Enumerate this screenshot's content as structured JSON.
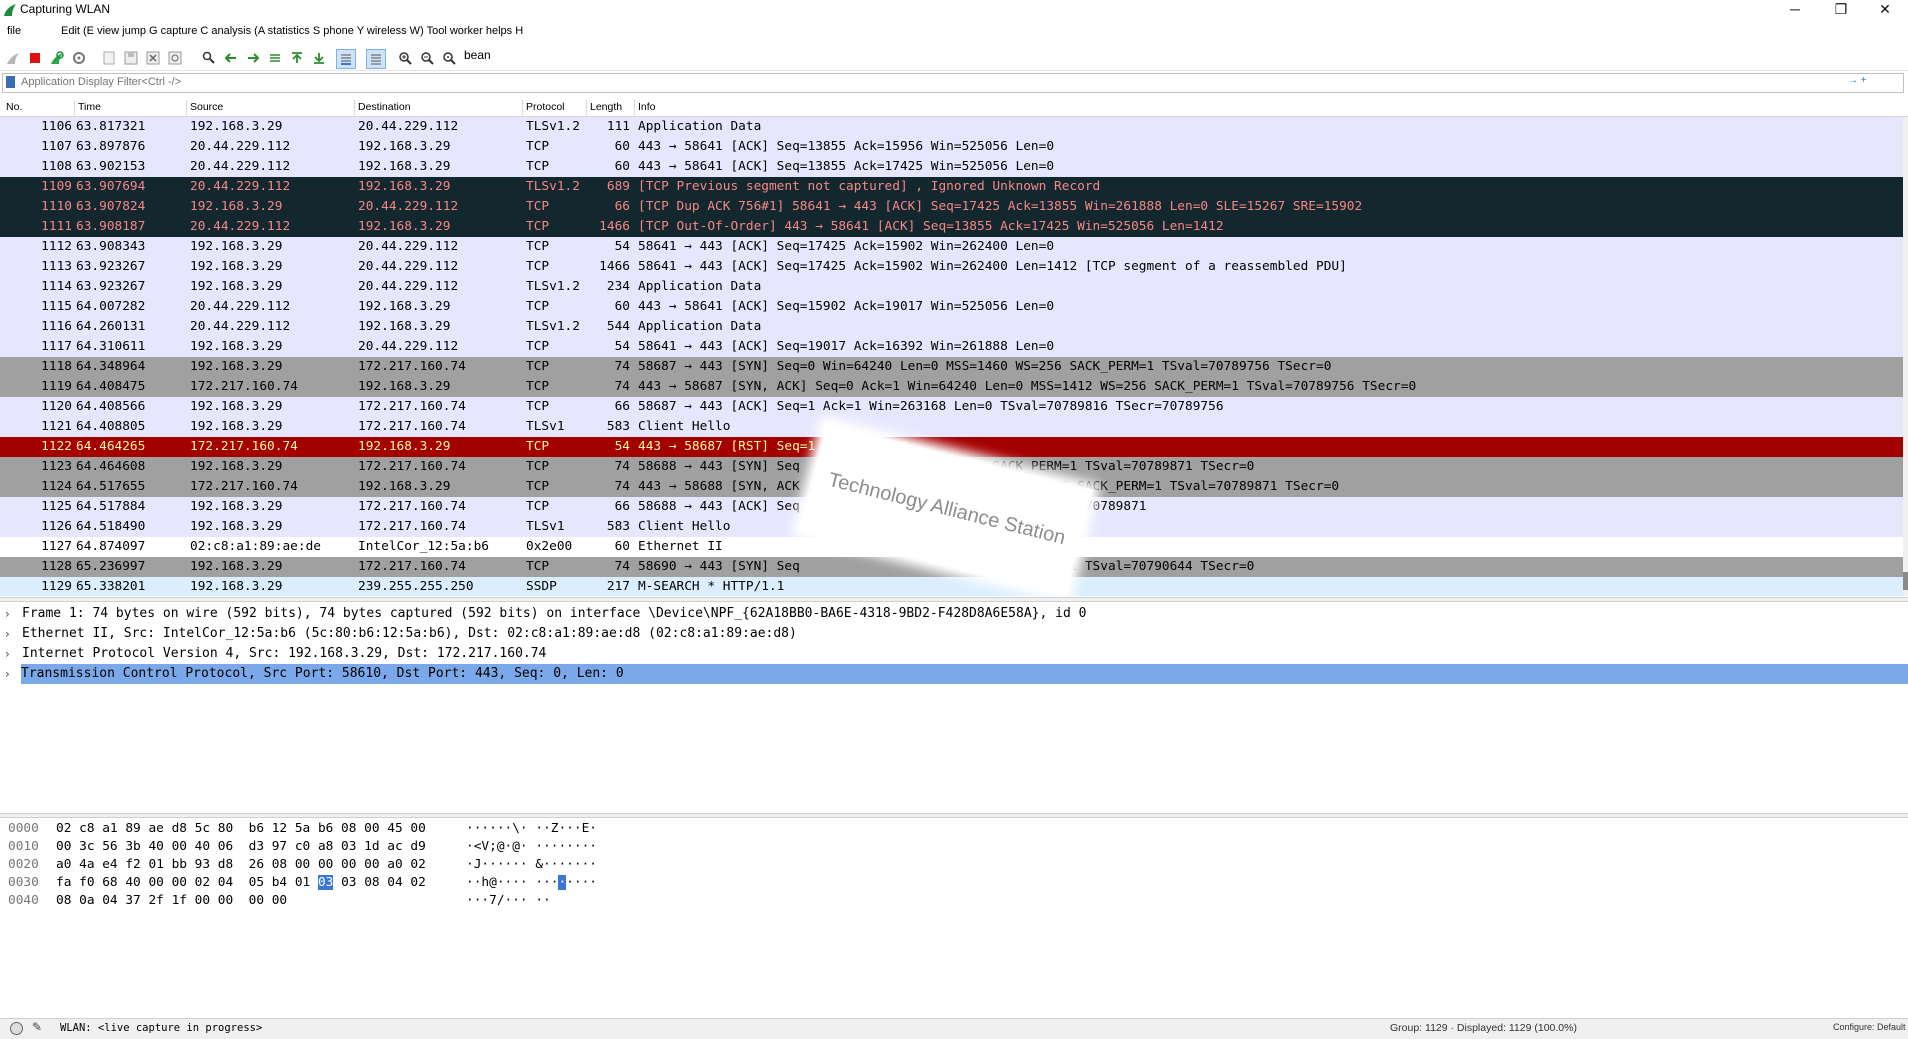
{
  "window": {
    "title": "Capturing WLAN",
    "controls": [
      "─",
      "❐",
      "✕"
    ]
  },
  "menu": {
    "items": [
      "file",
      "Edit (E view jump G capture C analysis (A statistics S phone Y wireless W) Tool worker helps H"
    ]
  },
  "toolbar": {
    "icons": [
      "shark-fin-start-icon",
      "stop-capture-icon",
      "restart-capture-icon",
      "capture-options-icon",
      "open-file-icon",
      "save-file-icon",
      "close-file-icon",
      "reload-file-icon",
      "find-packet-icon",
      "go-back-icon",
      "go-forward-icon",
      "go-to-packet-icon",
      "go-first-icon",
      "go-last-icon",
      "autoscroll-icon",
      "colorize-icon",
      "zoom-in-icon",
      "zoom-out-icon",
      "zoom-normal-icon"
    ],
    "extra_label": "bean"
  },
  "filter": {
    "placeholder": "Application Display Filter<Ctrl -/>"
  },
  "packet_list": {
    "columns": [
      "No.",
      "Time",
      "Source",
      "Destination",
      "Protocol",
      "Length",
      "Info"
    ],
    "rows": [
      {
        "no": "1106",
        "time": "63.817321",
        "src": "192.168.3.29",
        "dst": "20.44.229.112",
        "proto": "TLSv1.2",
        "len": "111",
        "info": "Application Data",
        "style": "tcp"
      },
      {
        "no": "1107",
        "time": "63.897876",
        "src": "20.44.229.112",
        "dst": "192.168.3.29",
        "proto": "TCP",
        "len": "60",
        "info": "443 → 58641 [ACK] Seq=13855 Ack=15956 Win=525056 Len=0",
        "style": "tcp"
      },
      {
        "no": "1108",
        "time": "63.902153",
        "src": "20.44.229.112",
        "dst": "192.168.3.29",
        "proto": "TCP",
        "len": "60",
        "info": "443 → 58641 [ACK] Seq=13855 Ack=17425 Win=525056 Len=0",
        "style": "tcp"
      },
      {
        "no": "1109",
        "time": "63.907694",
        "src": "20.44.229.112",
        "dst": "192.168.3.29",
        "proto": "TLSv1.2",
        "len": "689",
        "info": "[TCP Previous segment not captured] , Ignored Unknown Record",
        "style": "bad"
      },
      {
        "no": "1110",
        "time": "63.907824",
        "src": "192.168.3.29",
        "dst": "20.44.229.112",
        "proto": "TCP",
        "len": "66",
        "info": "[TCP Dup ACK 756#1] 58641 → 443 [ACK] Seq=17425 Ack=13855 Win=261888 Len=0 SLE=15267 SRE=15902",
        "style": "bad"
      },
      {
        "no": "1111",
        "time": "63.908187",
        "src": "20.44.229.112",
        "dst": "192.168.3.29",
        "proto": "TCP",
        "len": "1466",
        "info": "[TCP Out-Of-Order] 443 → 58641 [ACK] Seq=13855 Ack=17425 Win=525056 Len=1412",
        "style": "bad"
      },
      {
        "no": "1112",
        "time": "63.908343",
        "src": "192.168.3.29",
        "dst": "20.44.229.112",
        "proto": "TCP",
        "len": "54",
        "info": "58641 → 443 [ACK] Seq=17425 Ack=15902 Win=262400 Len=0",
        "style": "tcp"
      },
      {
        "no": "1113",
        "time": "63.923267",
        "src": "192.168.3.29",
        "dst": "20.44.229.112",
        "proto": "TCP",
        "len": "1466",
        "info": "58641 → 443 [ACK] Seq=17425 Ack=15902 Win=262400 Len=1412 [TCP segment of a reassembled PDU]",
        "style": "tcp"
      },
      {
        "no": "1114",
        "time": "63.923267",
        "src": "192.168.3.29",
        "dst": "20.44.229.112",
        "proto": "TLSv1.2",
        "len": "234",
        "info": "Application Data",
        "style": "tcp"
      },
      {
        "no": "1115",
        "time": "64.007282",
        "src": "20.44.229.112",
        "dst": "192.168.3.29",
        "proto": "TCP",
        "len": "60",
        "info": "443 → 58641 [ACK] Seq=15902 Ack=19017 Win=525056 Len=0",
        "style": "tcp"
      },
      {
        "no": "1116",
        "time": "64.260131",
        "src": "20.44.229.112",
        "dst": "192.168.3.29",
        "proto": "TLSv1.2",
        "len": "544",
        "info": "Application Data",
        "style": "tcp"
      },
      {
        "no": "1117",
        "time": "64.310611",
        "src": "192.168.3.29",
        "dst": "20.44.229.112",
        "proto": "TCP",
        "len": "54",
        "info": "58641 → 443 [ACK] Seq=19017 Ack=16392 Win=261888 Len=0",
        "style": "tcp"
      },
      {
        "no": "1118",
        "time": "64.348964",
        "src": "192.168.3.29",
        "dst": "172.217.160.74",
        "proto": "TCP",
        "len": "74",
        "info": "58687 → 443 [SYN] Seq=0 Win=64240 Len=0 MSS=1460 WS=256 SACK_PERM=1 TSval=70789756 TSecr=0",
        "style": "syn"
      },
      {
        "no": "1119",
        "time": "64.408475",
        "src": "172.217.160.74",
        "dst": "192.168.3.29",
        "proto": "TCP",
        "len": "74",
        "info": "443 → 58687 [SYN, ACK] Seq=0 Ack=1 Win=64240 Len=0 MSS=1412 WS=256 SACK_PERM=1 TSval=70789756 TSecr=0",
        "style": "syn"
      },
      {
        "no": "1120",
        "time": "64.408566",
        "src": "192.168.3.29",
        "dst": "172.217.160.74",
        "proto": "TCP",
        "len": "66",
        "info": "58687 → 443 [ACK] Seq=1 Ack=1 Win=263168 Len=0 TSval=70789816 TSecr=70789756",
        "style": "tcp"
      },
      {
        "no": "1121",
        "time": "64.408805",
        "src": "192.168.3.29",
        "dst": "172.217.160.74",
        "proto": "TLSv1",
        "len": "583",
        "info": "Client Hello",
        "style": "tcp"
      },
      {
        "no": "1122",
        "time": "64.464265",
        "src": "172.217.160.74",
        "dst": "192.168.3.29",
        "proto": "TCP",
        "len": "54",
        "info": "443 → 58687 [RST] Seq=1 Win=0 Len=0",
        "style": "rst"
      },
      {
        "no": "1123",
        "time": "64.464608",
        "src": "192.168.3.29",
        "dst": "172.217.160.74",
        "proto": "TCP",
        "len": "74",
        "info": "58688 → 443 [SYN] Seq                         SACK_PERM=1 TSval=70789871 TSecr=0",
        "style": "syn"
      },
      {
        "no": "1124",
        "time": "64.517655",
        "src": "172.217.160.74",
        "dst": "192.168.3.29",
        "proto": "TCP",
        "len": "74",
        "info": "443 → 58688 [SYN, ACK                         412 WS=256 SACK_PERM=1 TSval=70789871 TSecr=0",
        "style": "syn"
      },
      {
        "no": "1125",
        "time": "64.517884",
        "src": "192.168.3.29",
        "dst": "172.217.160.74",
        "proto": "TCP",
        "len": "66",
        "info": "58688 → 443 [ACK] Seq                         89925 TSecr=70789871",
        "style": "tcp"
      },
      {
        "no": "1126",
        "time": "64.518490",
        "src": "192.168.3.29",
        "dst": "172.217.160.74",
        "proto": "TLSv1",
        "len": "583",
        "info": "Client Hello",
        "style": "tcp"
      },
      {
        "no": "1127",
        "time": "64.874097",
        "src": "02:c8:a1:89:ae:de",
        "dst": "IntelCor_12:5a:b6",
        "proto": "0x2e00",
        "len": "60",
        "info": "Ethernet II",
        "style": "plain"
      },
      {
        "no": "1128",
        "time": "65.236997",
        "src": "192.168.3.29",
        "dst": "172.217.160.74",
        "proto": "TCP",
        "len": "74",
        "info": "58690 → 443 [SYN] Seq                         SACK_PERM=1 TSval=70790644 TSecr=0",
        "style": "syn"
      },
      {
        "no": "1129",
        "time": "65.338201",
        "src": "192.168.3.29",
        "dst": "239.255.255.250",
        "proto": "SSDP",
        "len": "217",
        "info": "M-SEARCH * HTTP/1.1",
        "style": "ssdp"
      }
    ]
  },
  "watermark": {
    "text": "Technology Alliance Station"
  },
  "details": {
    "rows": [
      {
        "text": "Frame 1: 74 bytes on wire (592 bits), 74 bytes captured (592 bits) on interface \\Device\\NPF_{62A18BB0-BA6E-4318-9BD2-F428D8A6E58A}, id 0",
        "selected": false
      },
      {
        "text": "Ethernet II, Src: IntelCor_12:5a:b6 (5c:80:b6:12:5a:b6), Dst: 02:c8:a1:89:ae:d8 (02:c8:a1:89:ae:d8)",
        "selected": false
      },
      {
        "text": "Internet Protocol Version 4, Src: 192.168.3.29, Dst: 172.217.160.74",
        "selected": false
      },
      {
        "text": "Transmission Control Protocol, Src Port: 58610, Dst Port: 443, Seq: 0, Len: 0",
        "selected": true
      }
    ]
  },
  "bytes": {
    "rows": [
      {
        "offset": "0000",
        "hex_a": "02 c8 a1 89 ae d8 5c 80  b6 12 5a b6 08 00 45 00",
        "hex_hl": "",
        "hex_b": "",
        "ascii_a": "······\\· ··Z···E·",
        "ascii_hl": "",
        "ascii_b": ""
      },
      {
        "offset": "0010",
        "hex_a": "00 3c 56 3b 40 00 40 06  d3 97 c0 a8 03 1d ac d9",
        "hex_hl": "",
        "hex_b": "",
        "ascii_a": "·<V;@·@· ········",
        "ascii_hl": "",
        "ascii_b": ""
      },
      {
        "offset": "0020",
        "hex_a": "a0 4a e4 f2 01 bb 93 d8  26 08 00 00 00 00 a0 02",
        "hex_hl": "",
        "hex_b": "",
        "ascii_a": "·J······ &·······",
        "ascii_hl": "",
        "ascii_b": ""
      },
      {
        "offset": "0030",
        "hex_a": "fa f0 68 40 00 00 02 04  05 b4 01 ",
        "hex_hl": "03",
        "hex_b": " 03 08 04 02",
        "ascii_a": "··h@···· ···",
        "ascii_hl": "·",
        "ascii_b": "····"
      },
      {
        "offset": "0040",
        "hex_a": "08 0a 04 37 2f 1f 00 00  00 00",
        "hex_hl": "",
        "hex_b": "",
        "ascii_a": "···7/··· ··",
        "ascii_hl": "",
        "ascii_b": ""
      }
    ]
  },
  "status": {
    "interface": "WLAN: <live capture in progress>",
    "stats": "Group: 1129 · Displayed: 1129 (100.0%)",
    "profile": "Configure: Default"
  },
  "colors": {
    "tcp_row": "#e7e6ff",
    "bad_row_bg": "#12272e",
    "bad_row_fg": "#f78787",
    "rst_row_bg": "#a40000",
    "rst_row_fg": "#fffc9c",
    "syn_row": "#a0a0a0",
    "ssdp_row": "#daeeff",
    "selection": "#7aa8e8"
  }
}
